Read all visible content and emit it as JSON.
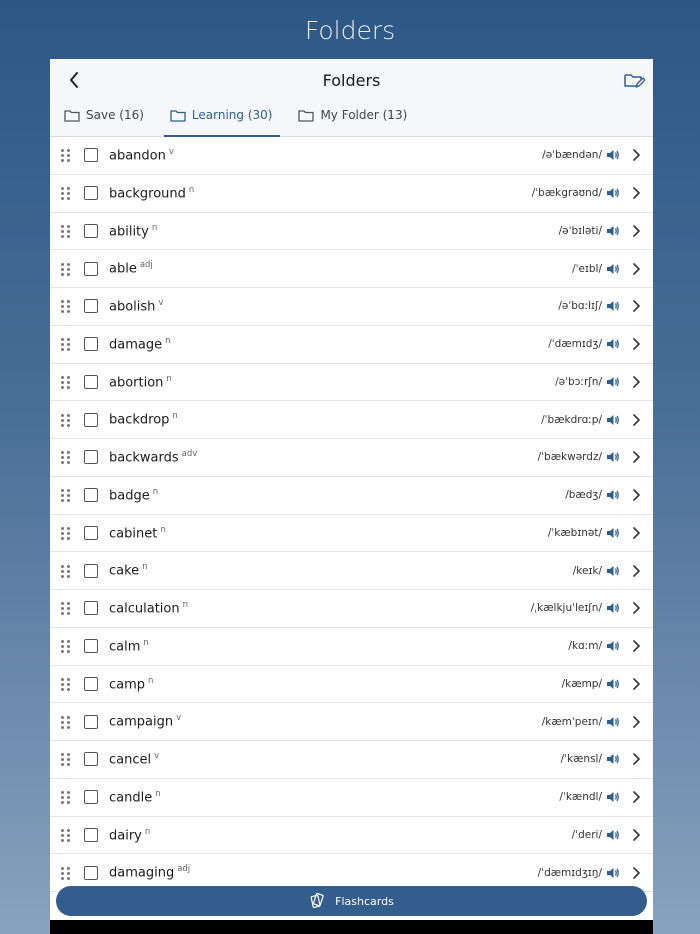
{
  "page": {
    "title": "Folders"
  },
  "nav": {
    "title": "Folders",
    "back_icon": "chevron-left-icon",
    "edit_icon": "folder-edit-icon"
  },
  "tabs": [
    {
      "label": "Save (16)",
      "icon": "folder-icon",
      "active": false
    },
    {
      "label": "Learning (30)",
      "icon": "folder-icon",
      "active": true
    },
    {
      "label": "My Folder (13)",
      "icon": "folder-icon",
      "active": false
    }
  ],
  "words": [
    {
      "word": "abandon",
      "pos": "v",
      "ipa": "/əˈbændən/"
    },
    {
      "word": "background",
      "pos": "n",
      "ipa": "/ˈbækgraʊnd/"
    },
    {
      "word": "ability",
      "pos": "n",
      "ipa": "/əˈbɪləti/"
    },
    {
      "word": "able",
      "pos": "adj",
      "ipa": "/ˈeɪbl/"
    },
    {
      "word": "abolish",
      "pos": "v",
      "ipa": "/əˈbɑːlɪʃ/"
    },
    {
      "word": "damage",
      "pos": "n",
      "ipa": "/ˈdæmɪdʒ/"
    },
    {
      "word": "abortion",
      "pos": "n",
      "ipa": "/əˈbɔːrʃn/"
    },
    {
      "word": "backdrop",
      "pos": "n",
      "ipa": "/ˈbækdrɑːp/"
    },
    {
      "word": "backwards",
      "pos": "adv",
      "ipa": "/ˈbækwərdz/"
    },
    {
      "word": "badge",
      "pos": "n",
      "ipa": "/bædʒ/"
    },
    {
      "word": "cabinet",
      "pos": "n",
      "ipa": "/ˈkæbɪnət/"
    },
    {
      "word": "cake",
      "pos": "n",
      "ipa": "/keɪk/"
    },
    {
      "word": "calculation",
      "pos": "n",
      "ipa": "/ˌkælkjuˈleɪʃn/"
    },
    {
      "word": "calm",
      "pos": "n",
      "ipa": "/kɑːm/"
    },
    {
      "word": "camp",
      "pos": "n",
      "ipa": "/kæmp/"
    },
    {
      "word": "campaign",
      "pos": "v",
      "ipa": "/kæmˈpeɪn/"
    },
    {
      "word": "cancel",
      "pos": "v",
      "ipa": "/ˈkænsl/"
    },
    {
      "word": "candle",
      "pos": "n",
      "ipa": "/ˈkændl/"
    },
    {
      "word": "dairy",
      "pos": "n",
      "ipa": "/ˈderi/"
    },
    {
      "word": "damaging",
      "pos": "adj",
      "ipa": "/ˈdæmɪdʒɪŋ/"
    }
  ],
  "footer": {
    "flashcards_label": "Flashcards",
    "flashcards_icon": "cards-icon"
  },
  "colors": {
    "accent": "#2f5f8f",
    "button": "#335d8d",
    "background_top": "#2d5785",
    "background_bottom": "#89a2bf"
  }
}
